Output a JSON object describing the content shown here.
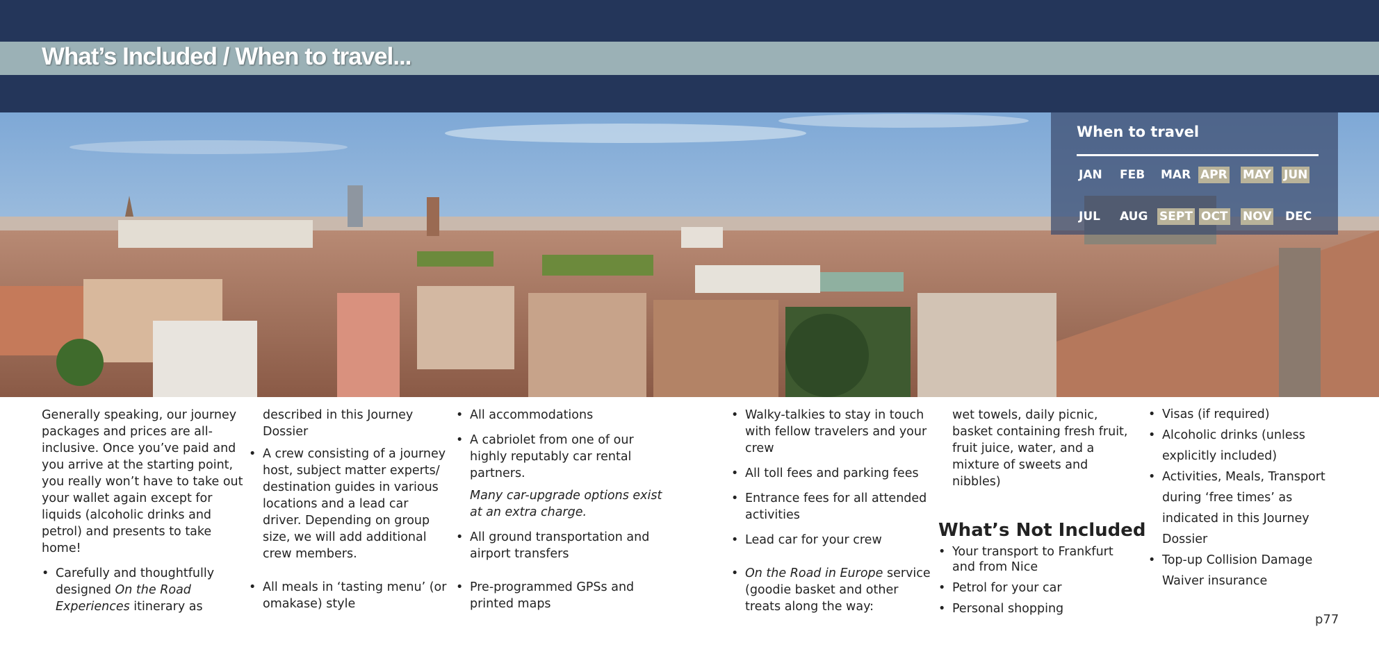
{
  "header": {
    "title": "What’s Included / When to travel..."
  },
  "when_to_travel": {
    "title": "When to travel",
    "months": [
      {
        "label": "JAN",
        "recommended": false
      },
      {
        "label": "FEB",
        "recommended": false
      },
      {
        "label": "MAR",
        "recommended": false
      },
      {
        "label": "APR",
        "recommended": true
      },
      {
        "label": "MAY",
        "recommended": true
      },
      {
        "label": "JUN",
        "recommended": true
      },
      {
        "label": "JUL",
        "recommended": false
      },
      {
        "label": "AUG",
        "recommended": false
      },
      {
        "label": "SEPT",
        "recommended": true
      },
      {
        "label": "OCT",
        "recommended": true
      },
      {
        "label": "NOV",
        "recommended": true
      },
      {
        "label": "DEC",
        "recommended": false
      }
    ],
    "highlight_color": "#b9b39a"
  },
  "included": {
    "intro": "Generally speaking, our journey packages and prices are all-inclusive. Once you’ve paid and you arrive at the starting point, you really won’t have to take out your wallet again except for liquids (alcoholic drinks and petrol) and presents to take home!",
    "item1_prefix": "Carefully and thoughtfully designed ",
    "item1_italic": "On the Road Experiences",
    "item1_suffix": " itinerary as",
    "item1_cont": "described in this Journey Dossier",
    "item2": "A crew consisting of a journey host, subject matter experts/ destination guides in various locations and a lead car driver. Depending on group size, we will add additional crew members.",
    "item3": "All meals in ‘tasting menu’ (or omakase) style",
    "item4": "All accommodations",
    "item5": "A cabriolet from one of our highly reputably car rental partners.",
    "item5_note": "Many car-upgrade options exist at an extra charge.",
    "item6": "All ground transportation and airport transfers",
    "item7": "Pre-programmed GPSs and printed maps",
    "item8": "Walky-talkies to stay in touch with fellow travelers and your crew",
    "item9": "All toll fees and parking fees",
    "item10": "Entrance fees for all attended activities",
    "item11": "Lead car for your crew",
    "item12_italic": "On the Road in Europe",
    "item12_suffix": " service (goodie basket and other treats along the way:",
    "item12_cont": "wet towels, daily picnic, basket containing fresh fruit, fruit juice, water, and a mixture of sweets and nibbles)"
  },
  "not_included": {
    "heading": "What’s Not Included",
    "items": [
      "Your transport to Frankfurt and from Nice",
      "Petrol for your car",
      "Personal shopping",
      "Visas (if required)",
      "Alcoholic drinks (unless explicitly included)",
      "Activities, Meals, Transport during ‘free times’ as indicated in this Journey Dossier",
      "Top-up Collision Damage Waiver insurance"
    ]
  },
  "page_number": "p77",
  "colors": {
    "navy": "#24365a",
    "title_band": "#9bb1b6"
  }
}
